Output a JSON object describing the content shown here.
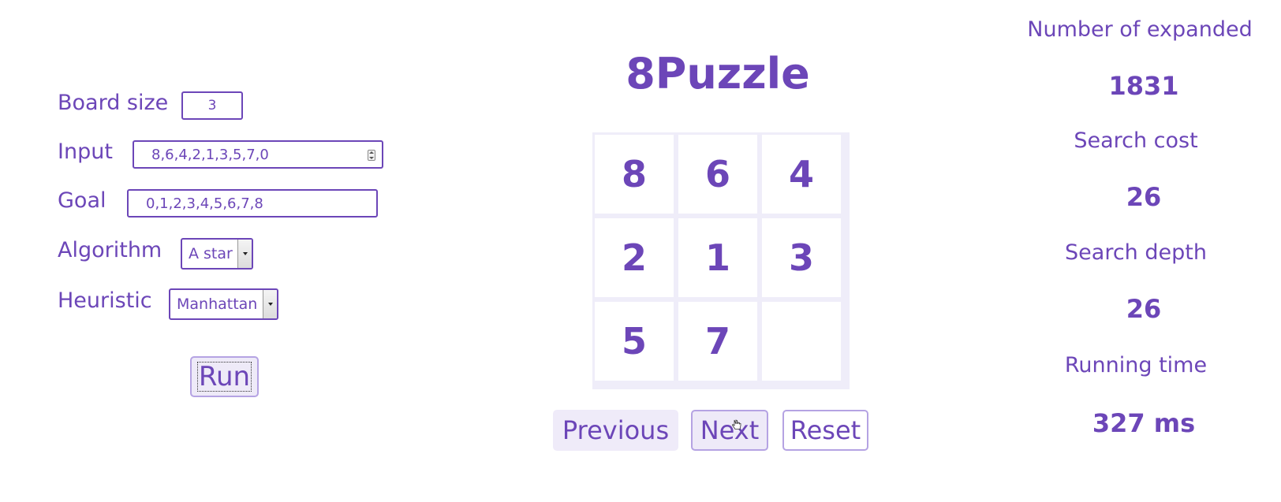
{
  "form": {
    "board_size": {
      "label": "Board size",
      "value": "3"
    },
    "input": {
      "label": "Input",
      "value": "8,6,4,2,1,3,5,7,0"
    },
    "goal": {
      "label": "Goal",
      "value": "0,1,2,3,4,5,6,7,8"
    },
    "algorithm": {
      "label": "Algorithm",
      "selected": "A star"
    },
    "heuristic": {
      "label": "Heuristic",
      "selected": "Manhattan"
    },
    "run_label": "Run"
  },
  "puzzle": {
    "title": "8Puzzle",
    "tiles": [
      "8",
      "6",
      "4",
      "2",
      "1",
      "3",
      "5",
      "7",
      ""
    ],
    "previous_label": "Previous",
    "next_label": "Next",
    "reset_label": "Reset"
  },
  "stats": {
    "expanded_label": "Number of expanded",
    "expanded_value": "1831",
    "cost_label": "Search cost",
    "cost_value": "26",
    "depth_label": "Search depth",
    "depth_value": "26",
    "time_label": "Running time",
    "time_value": "327 ms"
  },
  "colors": {
    "accent": "#6c46b8",
    "button_bg": "#eeeaf8",
    "button_border": "#b5a3e3",
    "board_grid": "#efedf9"
  }
}
